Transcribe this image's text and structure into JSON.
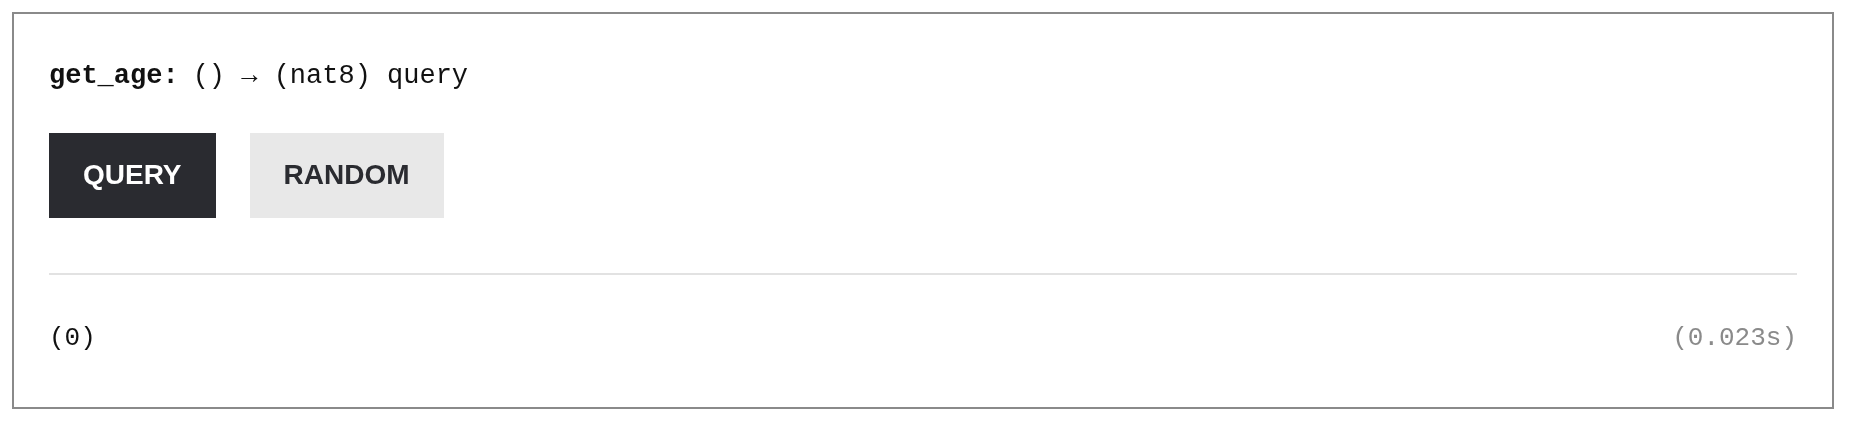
{
  "method": {
    "name": "get_age:",
    "signature": "() → (nat8) query"
  },
  "buttons": [
    {
      "label": "QUERY",
      "kind": "primary"
    },
    {
      "label": "RANDOM",
      "kind": "secondary"
    }
  ],
  "result": {
    "value": "(0)",
    "time": "(0.023s)"
  }
}
